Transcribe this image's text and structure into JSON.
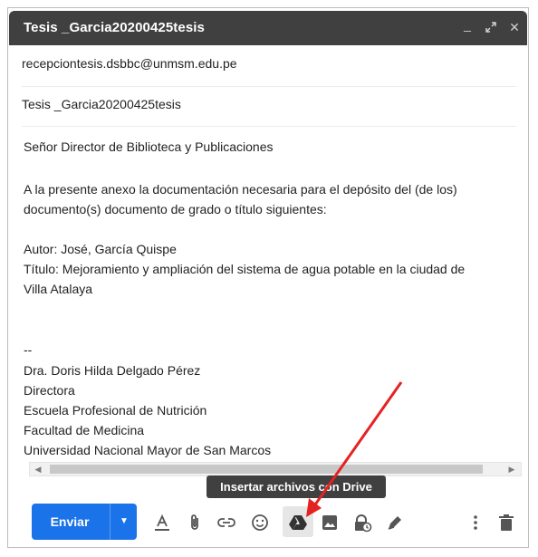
{
  "window": {
    "title": "Tesis _Garcia20200425tesis",
    "controls": {
      "minimize": "_",
      "expand": "⤢",
      "close": "✕"
    }
  },
  "to": "recepciontesis.dsbbc@unmsm.edu.pe",
  "subject": "Tesis _Garcia20200425tesis",
  "body": {
    "greeting": "Señor Director de Biblioteca y Publicaciones",
    "intro_line1": "A la presente anexo la documentación necesaria para el depósito del (de los)",
    "intro_line2": "documento(s) documento de grado o título siguientes:",
    "author": "Autor: José, García Quispe",
    "title_line1": "Título: Mejoramiento y ampliación del sistema de agua potable en la ciudad de",
    "title_line2": "Villa Atalaya",
    "sig_sep": "--",
    "sig_name": "Dra. Doris Hilda Delgado Pérez",
    "sig_role": "Directora",
    "sig_school": "Escuela Profesional de Nutrición",
    "sig_faculty": "Facultad de Medicina",
    "sig_university": "Universidad Nacional Mayor de San Marcos"
  },
  "tooltip": "Insertar archivos con Drive",
  "toolbar": {
    "send_label": "Enviar",
    "icons": [
      "formatting-icon",
      "attach-icon",
      "link-icon",
      "emoji-icon",
      "drive-icon",
      "photo-icon",
      "confidential-icon",
      "signature-icon",
      "more-options-icon",
      "trash-icon"
    ]
  },
  "colors": {
    "titlebar": "#404040",
    "send_button": "#1a73e8",
    "annotation_arrow": "#e52222"
  }
}
